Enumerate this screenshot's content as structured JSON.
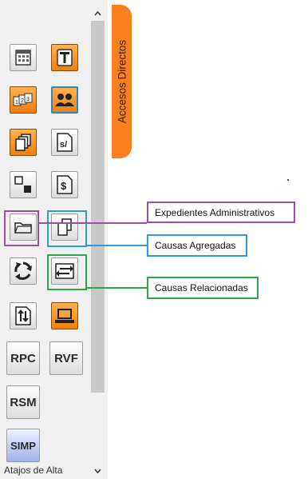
{
  "panel": {
    "footer_label": "Atajos de Alta",
    "scroll_up_glyph": "^",
    "scroll_down_glyph": "v"
  },
  "side_tab": {
    "label": "Accesos Directos",
    "color": "#f7811c"
  },
  "buttons": {
    "calendar": {
      "icon": "calendar-grid-icon"
    },
    "text": {
      "icon": "letter-t-icon",
      "glyph": "T"
    },
    "numbered_cards": {
      "icon": "numbered-cards-icon",
      "glyph": "1 2 3"
    },
    "users": {
      "icon": "users-icon"
    },
    "documents_stack": {
      "icon": "document-stack-icon"
    },
    "section": {
      "icon": "sign-document-icon",
      "glyph": "s/"
    },
    "windows": {
      "icon": "window-corners-icon"
    },
    "money_doc": {
      "icon": "money-document-icon",
      "glyph": "$"
    },
    "folder": {
      "icon": "folder-icon"
    },
    "copies": {
      "icon": "copies-icon"
    },
    "refresh": {
      "icon": "recycle-arrows-icon"
    },
    "exchange": {
      "icon": "exchange-arrows-icon"
    },
    "transfer": {
      "icon": "up-down-transfer-icon"
    },
    "monitor": {
      "icon": "laptop-icon"
    },
    "rpc": {
      "label": "RPC"
    },
    "rvf": {
      "label": "RVF"
    },
    "rsm": {
      "label": "RSM"
    },
    "simp": {
      "label": "SIMP"
    }
  },
  "callouts": {
    "expedientes": {
      "label": "Expedientes Administrativos",
      "color": "#9b4fa8"
    },
    "agregadas": {
      "label": "Causas Agregadas",
      "color": "#2f9ad8"
    },
    "relacionadas": {
      "label": "Causas Relacionadas",
      "color": "#2aa84a"
    }
  }
}
